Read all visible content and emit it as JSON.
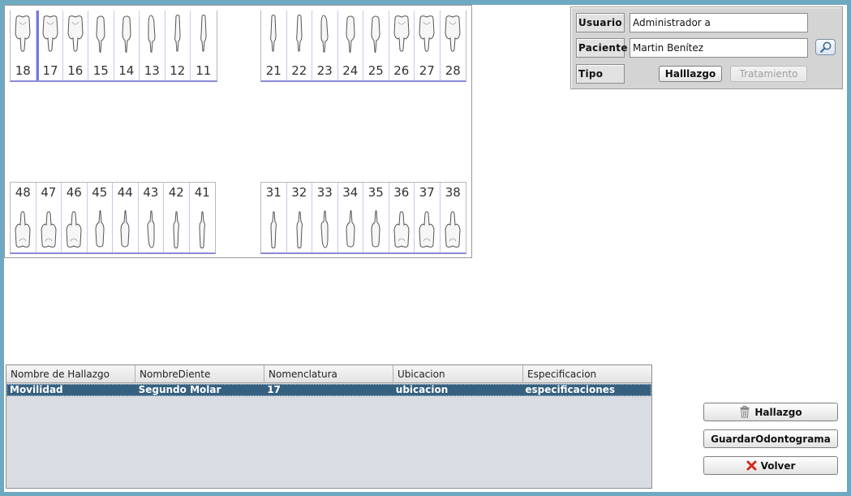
{
  "odontogram": {
    "upper_right": [
      "18",
      "17",
      "16",
      "15",
      "14",
      "13",
      "12",
      "11"
    ],
    "upper_left": [
      "21",
      "22",
      "23",
      "24",
      "25",
      "26",
      "27",
      "28"
    ],
    "lower_right": [
      "48",
      "47",
      "46",
      "45",
      "44",
      "43",
      "42",
      "41"
    ],
    "lower_left": [
      "31",
      "32",
      "33",
      "34",
      "35",
      "36",
      "37",
      "38"
    ],
    "selected_tooth": "17"
  },
  "info": {
    "usuario_label": "Usuario",
    "usuario_value": "Administrador a",
    "paciente_label": "Paciente",
    "paciente_value": "Martin Benítez",
    "tipo_label": "Tipo",
    "hallazgo_btn": "Halllazgo",
    "tratamiento_btn": "Tratamiento"
  },
  "table": {
    "headers": [
      "Nombre de Hallazgo",
      "NombreDiente",
      "Nomenclatura",
      "Ubicacion",
      "Especificacion"
    ],
    "rows": [
      [
        "Movilidad",
        "Segundo Molar",
        "17",
        "ubicacion",
        "especificaciones"
      ]
    ]
  },
  "actions": {
    "hallazgo": "Hallazgo",
    "guardar": "GuardarOdontograma",
    "volver": "Volver"
  },
  "colors": {
    "frame": "#6fa9c1",
    "selected_row": "#36607f",
    "quadrant_line": "#8a8ad8"
  }
}
